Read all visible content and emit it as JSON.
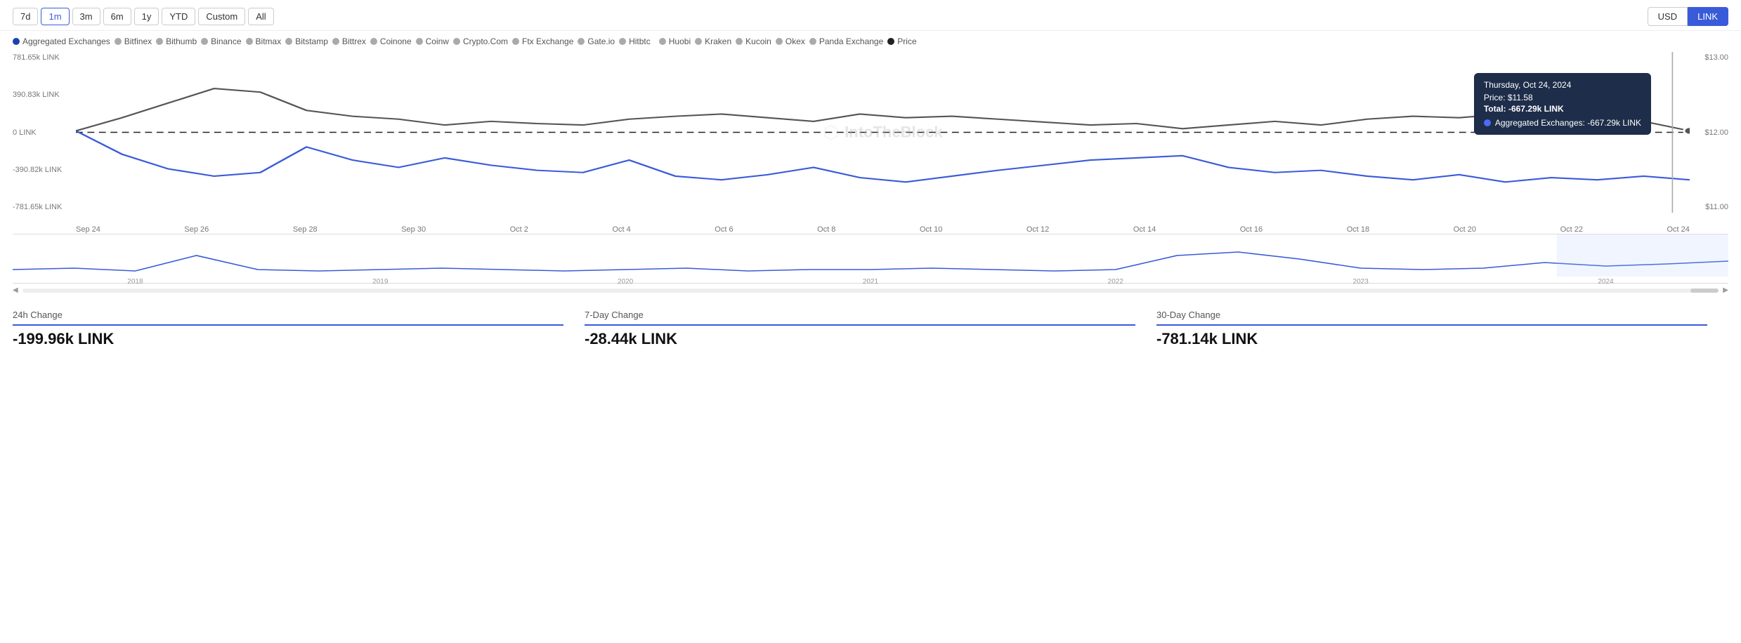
{
  "timeButtons": [
    "7d",
    "1m",
    "3m",
    "6m",
    "1y",
    "YTD",
    "Custom",
    "All"
  ],
  "activeTime": "1m",
  "currencies": [
    "USD",
    "LINK"
  ],
  "activeCurrency": "LINK",
  "legend": [
    {
      "label": "Aggregated Exchanges",
      "type": "blue"
    },
    {
      "label": "Bitfinex",
      "type": "gray"
    },
    {
      "label": "Bithumb",
      "type": "gray"
    },
    {
      "label": "Binance",
      "type": "gray"
    },
    {
      "label": "Bitmax",
      "type": "gray"
    },
    {
      "label": "Bitstamp",
      "type": "gray"
    },
    {
      "label": "Bittrex",
      "type": "gray"
    },
    {
      "label": "Coinone",
      "type": "gray"
    },
    {
      "label": "Coinw",
      "type": "gray"
    },
    {
      "label": "Crypto.Com",
      "type": "gray"
    },
    {
      "label": "Ftx Exchange",
      "type": "gray"
    },
    {
      "label": "Gate.io",
      "type": "gray"
    },
    {
      "label": "Hitbtc",
      "type": "gray"
    },
    {
      "label": "Huobi",
      "type": "gray"
    },
    {
      "label": "Kraken",
      "type": "gray"
    },
    {
      "label": "Kucoin",
      "type": "gray"
    },
    {
      "label": "Okex",
      "type": "gray"
    },
    {
      "label": "Panda Exchange",
      "type": "gray"
    },
    {
      "label": "Price",
      "type": "dark"
    }
  ],
  "yLabels": {
    "left": [
      "781.65k LINK",
      "390.83k LINK",
      "0 LINK",
      "-390.82k LINK",
      "-781.65k LINK"
    ],
    "right": [
      "$13.00",
      "$12.00",
      "$11.00"
    ]
  },
  "xLabels": [
    "Sep 24",
    "Sep 26",
    "Sep 28",
    "Sep 30",
    "Oct 2",
    "Oct 4",
    "Oct 6",
    "Oct 8",
    "Oct 10",
    "Oct 12",
    "Oct 14",
    "Oct 16",
    "Oct 18",
    "Oct 20",
    "Oct 22",
    "Oct 24"
  ],
  "watermark": "IntoTheBlock",
  "tooltip": {
    "date": "Thursday, Oct 24, 2024",
    "price": "Price: $11.58",
    "total": "Total: -667.29k LINK",
    "exchange": "Aggregated Exchanges: -667.29k LINK"
  },
  "miniXLabels": [
    "2018",
    "2019",
    "2020",
    "2021",
    "2022",
    "2023",
    "2024"
  ],
  "stats": [
    {
      "label": "24h Change",
      "value": "-199.96k LINK"
    },
    {
      "label": "7-Day Change",
      "value": "-28.44k LINK"
    },
    {
      "label": "30-Day Change",
      "value": "-781.14k LINK"
    }
  ]
}
